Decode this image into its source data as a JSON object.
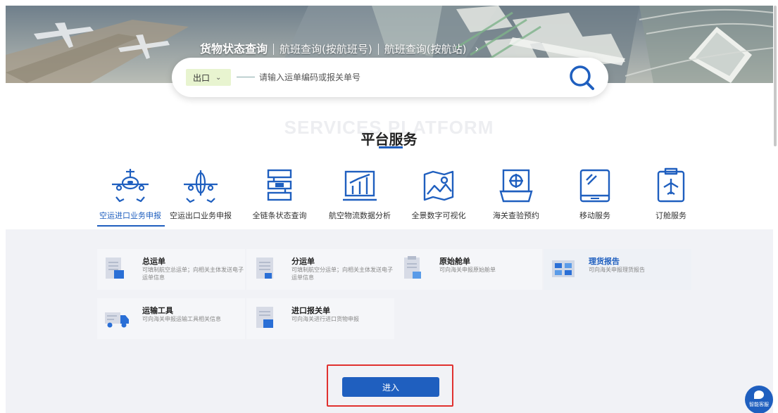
{
  "header": {
    "tabs": [
      {
        "label": "货物状态查询",
        "active": true
      },
      {
        "label": "航班查询(按航班号)",
        "active": false
      },
      {
        "label": "航班查询(按航站)",
        "active": false
      }
    ],
    "arrow": "›"
  },
  "search": {
    "select_value": "出口",
    "placeholder": "请输入运单编码或报关单号"
  },
  "section": {
    "bg_text": "SERVICES PLATFORM",
    "title": "平台服务"
  },
  "services": [
    {
      "label": "空运进口业务申报",
      "icon": "plane-inbound-icon",
      "active": true
    },
    {
      "label": "空运出口业务申报",
      "icon": "plane-outbound-icon",
      "active": false
    },
    {
      "label": "全链条状态查询",
      "icon": "flow-status-icon",
      "active": false
    },
    {
      "label": "航空物流数据分析",
      "icon": "bar-chart-icon",
      "active": false
    },
    {
      "label": "全景数字可视化",
      "icon": "map-icon",
      "active": false
    },
    {
      "label": "海关查验预约",
      "icon": "inspection-icon",
      "active": false
    },
    {
      "label": "移动服务",
      "icon": "tablet-icon",
      "active": false
    },
    {
      "label": "订舱服务",
      "icon": "booking-icon",
      "active": false
    }
  ],
  "cards": [
    {
      "title": "总运单",
      "desc": "可填制航空总运单；向相关主体发送电子运单信息",
      "icon": "document-icon"
    },
    {
      "title": "分运单",
      "desc": "可填制航空分运单；向相关主体发送电子运单信息",
      "icon": "document-icon"
    },
    {
      "title": "原始舱单",
      "desc": "可向海关申报原始舱单",
      "icon": "manifest-icon"
    },
    {
      "title": "理货报告",
      "desc": "可向海关申报理货报告",
      "icon": "tally-icon"
    },
    {
      "title": "运输工具",
      "desc": "可向海关申报运输工具相关信息",
      "icon": "truck-icon"
    },
    {
      "title": "进口报关单",
      "desc": "可向海关进行进口货物申报",
      "icon": "declaration-icon"
    }
  ],
  "enter_button": "进入",
  "chat": {
    "label": "智能客服"
  },
  "colors": {
    "primary": "#1f5fbf",
    "highlight": "#e0312f",
    "panel": "#f1f2f6"
  }
}
